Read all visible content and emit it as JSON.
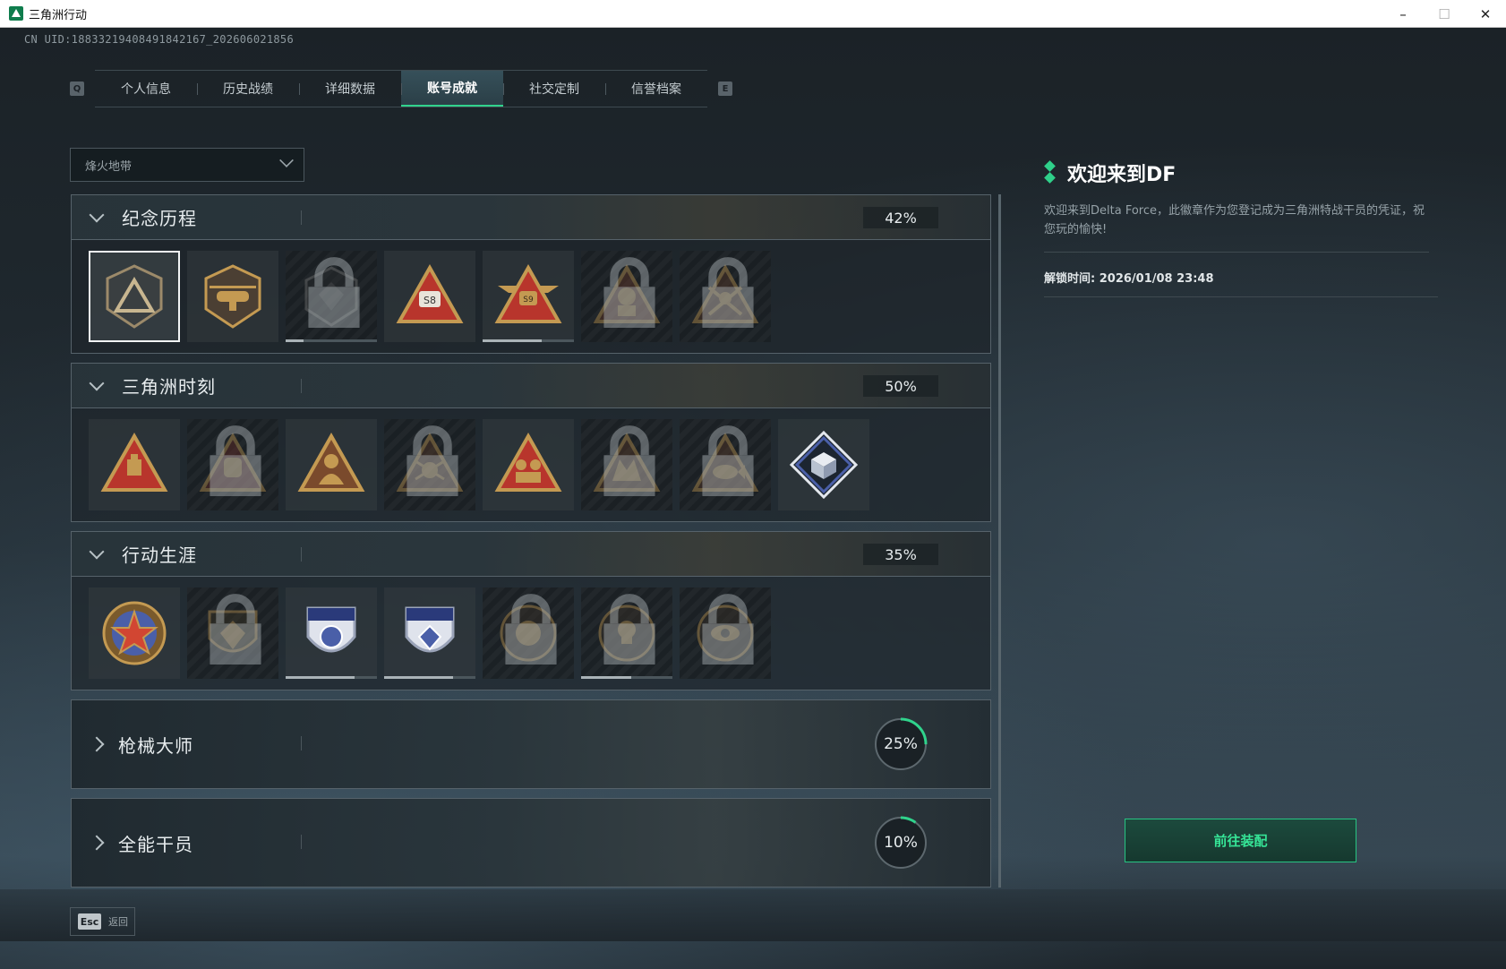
{
  "window": {
    "title": "三角洲行动",
    "minimize": "–",
    "maximize": "☐",
    "close": "✕"
  },
  "uid": "CN UID:188332194084918421​67_202606021856",
  "tabs": {
    "left_key": "Q",
    "right_key": "E",
    "items": [
      {
        "label": "个人信息",
        "active": false
      },
      {
        "label": "历史战绩",
        "active": false
      },
      {
        "label": "详细数据",
        "active": false
      },
      {
        "label": "账号成就",
        "active": true
      },
      {
        "label": "社交定制",
        "active": false
      },
      {
        "label": "信誉档案",
        "active": false
      }
    ]
  },
  "filter": {
    "selected": "烽火地带"
  },
  "sections": [
    {
      "title": "纪念历程",
      "percent": "42%",
      "expanded": true,
      "style": "box",
      "badges": [
        {
          "icon": "triangle-shield-badge",
          "locked": false,
          "selected": true
        },
        {
          "icon": "helicopter-badge",
          "locked": false
        },
        {
          "icon": "hex-emblem-badge",
          "locked": true,
          "progress": 0.2
        },
        {
          "icon": "s8-triangle-badge",
          "locked": false
        },
        {
          "icon": "s9-winged-badge",
          "locked": false,
          "progress": 0.65
        },
        {
          "icon": "soldier-triangle-badge",
          "locked": true
        },
        {
          "icon": "crossed-rifles-badge",
          "locked": true
        }
      ]
    },
    {
      "title": "三角洲时刻",
      "percent": "50%",
      "expanded": true,
      "style": "box",
      "badges": [
        {
          "icon": "flag-triangle-badge",
          "locked": false
        },
        {
          "icon": "mask-triangle-badge",
          "locked": true
        },
        {
          "icon": "hooded-figure-badge",
          "locked": false
        },
        {
          "icon": "spider-triangle-badge",
          "locked": true
        },
        {
          "icon": "squad-triangle-badge",
          "locked": false
        },
        {
          "icon": "beast-triangle-badge",
          "locked": true
        },
        {
          "icon": "fish-triangle-badge",
          "locked": true
        },
        {
          "icon": "cube-diamond-badge",
          "locked": false
        }
      ]
    },
    {
      "title": "行动生涯",
      "percent": "35%",
      "expanded": true,
      "style": "box",
      "badges": [
        {
          "icon": "star-medal-badge",
          "locked": false
        },
        {
          "icon": "eagle-shield-badge",
          "locked": true
        },
        {
          "icon": "blue-shield-badge",
          "locked": false,
          "progress": 0.75
        },
        {
          "icon": "blue-crest-badge",
          "locked": false,
          "progress": 0.75
        },
        {
          "icon": "round-seal-badge",
          "locked": true
        },
        {
          "icon": "skull-round-badge",
          "locked": true,
          "progress": 0.55
        },
        {
          "icon": "eye-round-badge",
          "locked": true
        }
      ]
    },
    {
      "title": "枪械大师",
      "percent": "25%",
      "percent_value": 0.25,
      "expanded": false,
      "style": "ring"
    },
    {
      "title": "全能干员",
      "percent": "10%",
      "percent_value": 0.1,
      "expanded": false,
      "style": "ring"
    }
  ],
  "detail": {
    "title": "欢迎来到DF",
    "description": "欢迎来到Delta Force，此徽章作为您登记成为三角洲特战干员的凭证，祝您玩的愉快!",
    "unlock_time": "解锁时间: 2026/01/08 23:48"
  },
  "equip_button": "前往装配",
  "footer": {
    "esc_key": "Esc",
    "esc_label": "返回"
  },
  "colors": {
    "accent": "#30d38c",
    "gold": "#c49a52",
    "red": "#b8352c",
    "blue": "#4a5fa8"
  }
}
